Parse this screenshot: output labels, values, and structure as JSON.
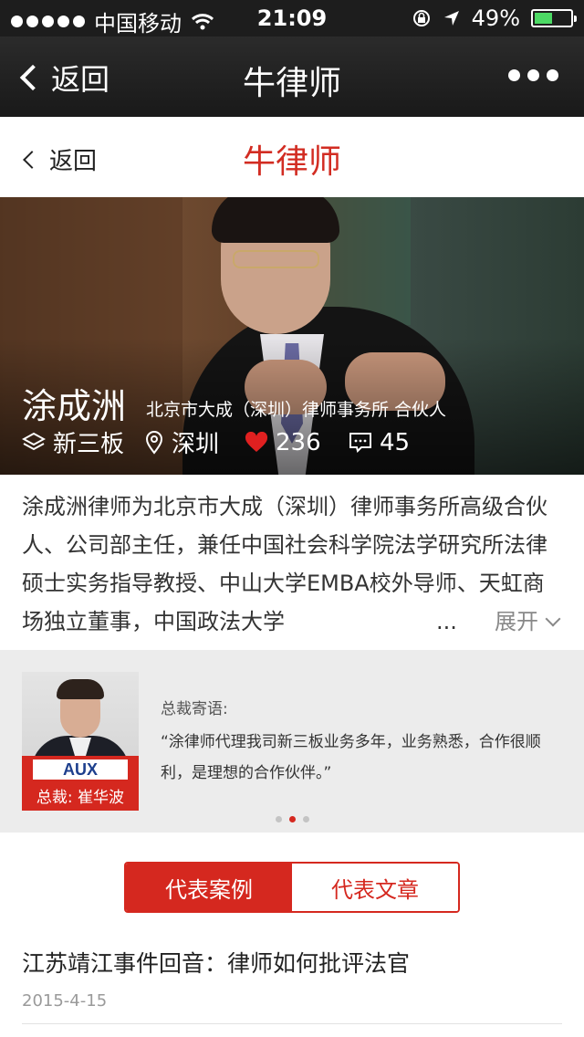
{
  "status_bar": {
    "carrier": "中国移动",
    "time": "21:09",
    "battery_percent": "49%",
    "battery_level": 0.49,
    "icons": [
      "signal-dots-icon",
      "wifi-icon",
      "rotation-lock-icon",
      "location-arrow-icon",
      "battery-icon"
    ]
  },
  "nav": {
    "back_label": "返回",
    "title": "牛律师",
    "more_icon": "more-dots-icon"
  },
  "page_header": {
    "back_label": "返回",
    "title": "牛律师"
  },
  "profile": {
    "name": "涂成洲",
    "position": "北京市大成（深圳）律师事务所 合伙人",
    "specialty": "新三板",
    "city": "深圳",
    "likes": "236",
    "comments": "45"
  },
  "intro": {
    "text": "涂成洲律师为北京市大成（深圳）律师事务所高级合伙人、公司部主任，兼任中国社会科学院法学研究所法律硕士实务指导教授、中山大学EMBA校外导师、天虹商场独立董事，中国政法大学",
    "ellipsis": "...",
    "expand_label": "展开"
  },
  "testimonial": {
    "brand": "AUX",
    "person_caption": "总裁: 崔华波",
    "label": "总裁寄语:",
    "quote": "“涂律师代理我司新三板业务多年，业务熟悉，合作很顺利，是理想的合作伙伴。”",
    "dots_count": 3,
    "active_dot": 1
  },
  "tabs": {
    "cases": "代表案例",
    "articles": "代表文章",
    "active": "cases"
  },
  "list": [
    {
      "title": "江苏靖江事件回音：律师如何批评法官",
      "date": "2015-4-15"
    }
  ],
  "colors": {
    "accent": "#d5281f",
    "nav_bg": "#1d1d1d",
    "battery_green": "#4cd964"
  }
}
